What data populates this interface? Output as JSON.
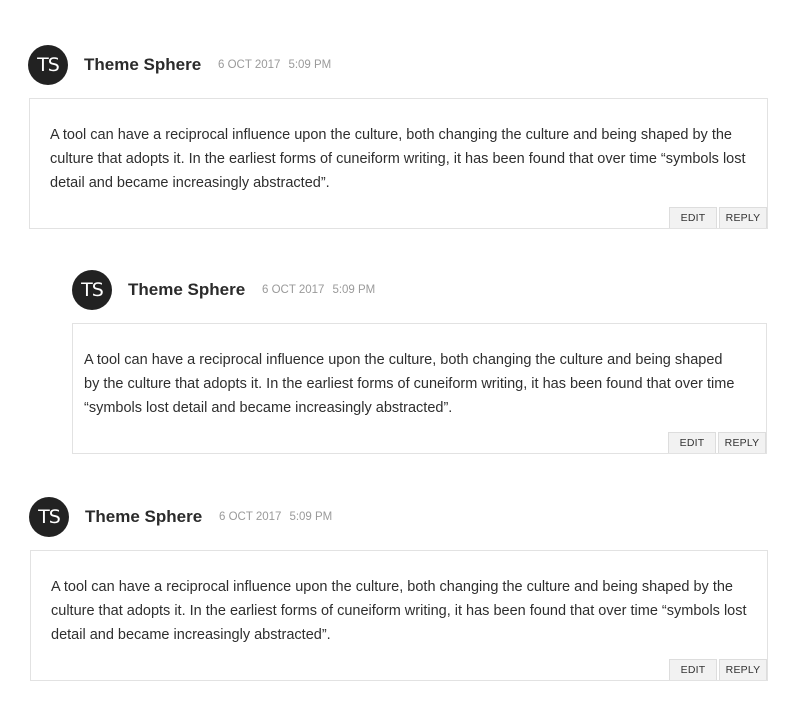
{
  "comments": [
    {
      "avatar_initials": "TS",
      "author": "Theme Sphere",
      "date": "6 OCT 2017",
      "time": "5:09 PM",
      "text": "A tool can have a reciprocal influence upon the culture, both changing the culture and being shaped by the culture that adopts it. In the earliest forms of cuneiform writing, it has been found that over time “symbols lost detail and became increasingly abstracted”.",
      "edit_label": "EDIT",
      "reply_label": "REPLY"
    },
    {
      "avatar_initials": "TS",
      "author": "Theme Sphere",
      "date": "6 OCT 2017",
      "time": "5:09 PM",
      "text": "A tool can have a reciprocal influence upon the culture, both changing the culture and being shaped by the culture that adopts it. In the earliest forms of cuneiform writing, it has been found that over time “symbols lost detail and became increasingly abstracted”.",
      "edit_label": "EDIT",
      "reply_label": "REPLY"
    },
    {
      "avatar_initials": "TS",
      "author": "Theme Sphere",
      "date": "6 OCT 2017",
      "time": "5:09 PM",
      "text": "A tool can have a reciprocal influence upon the culture, both changing the culture and being shaped by the culture that adopts it. In the earliest forms of cuneiform writing, it has been found that over time “symbols lost detail and became increasingly abstracted”.",
      "edit_label": "EDIT",
      "reply_label": "REPLY"
    }
  ],
  "colors": {
    "avatar_bg": "#222222",
    "meta_text": "#9a9a9a",
    "border": "#e2e2e2",
    "button_bg": "#f2f2f2"
  }
}
